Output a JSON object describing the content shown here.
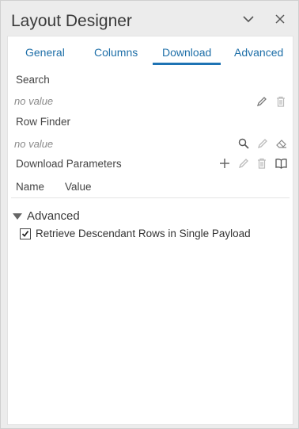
{
  "window": {
    "title": "Layout Designer"
  },
  "colors": {
    "accent": "#1e73b4",
    "tab_text": "#1e6fa8",
    "placeholder": "#8a8a8a"
  },
  "tabs": [
    {
      "label": "General",
      "active": false
    },
    {
      "label": "Columns",
      "active": false
    },
    {
      "label": "Download",
      "active": true
    },
    {
      "label": "Advanced",
      "active": false
    }
  ],
  "search": {
    "label": "Search",
    "value": "no value"
  },
  "row_finder": {
    "label": "Row Finder",
    "value": "no value"
  },
  "download_parameters": {
    "label": "Download Parameters",
    "columns": {
      "name": "Name",
      "value": "Value"
    }
  },
  "advanced_section": {
    "title": "Advanced",
    "expanded": true,
    "retrieve_descendants": {
      "label": "Retrieve Descendant Rows in Single Payload",
      "checked": true
    }
  },
  "icons": {
    "title_bar": [
      "chevron-down-icon",
      "close-icon"
    ],
    "search": [
      "pencil-icon",
      "trash-icon"
    ],
    "row_finder": [
      "search-icon",
      "pencil-icon",
      "eraser-icon"
    ],
    "download_parameters": [
      "plus-icon",
      "pencil-icon",
      "trash-icon",
      "book-icon"
    ]
  }
}
